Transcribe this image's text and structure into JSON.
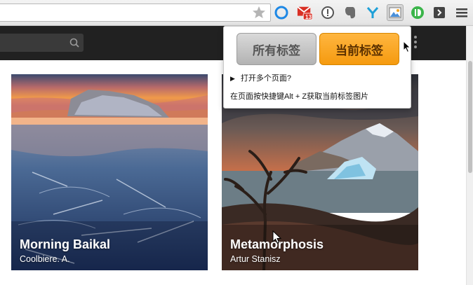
{
  "browser": {
    "omnibox_value": "",
    "extensions": [
      {
        "name": "circle-extension-icon",
        "color": "#1e88e5"
      },
      {
        "name": "gmail-icon",
        "badge": "13"
      },
      {
        "name": "info-extension-icon"
      },
      {
        "name": "evernote-icon"
      },
      {
        "name": "y-extension-icon",
        "color": "#1ea0d8"
      },
      {
        "name": "screenshot-extension-icon"
      },
      {
        "name": "pushbullet-icon",
        "color": "#3bb54a"
      },
      {
        "name": "pocket-arrow-icon"
      },
      {
        "name": "menu-icon"
      }
    ]
  },
  "popup": {
    "all_tabs_label": "所有标签",
    "current_tab_label": "当前标签",
    "open_multiple": "打开多个页面?",
    "shortcut_hint": "在页面按快捷键Alt + Z获取当前标签图片",
    "accent_color": "#f59a0f"
  },
  "gallery": {
    "cards": [
      {
        "title": "Morning Baikal",
        "author": "Coolbiere. A."
      },
      {
        "title": "Metamorphosis",
        "author": "Artur Stanisz"
      }
    ]
  }
}
